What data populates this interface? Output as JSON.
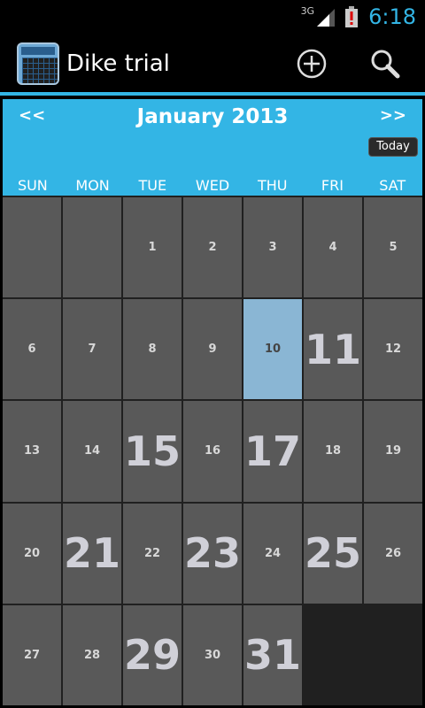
{
  "status_bar": {
    "network": "3G",
    "time": "6:18",
    "accent": "#33b5e5"
  },
  "action_bar": {
    "title": "Dike trial",
    "icons": [
      "calendar-app-icon",
      "add-icon",
      "search-icon"
    ]
  },
  "calendar": {
    "nav_prev": "<<",
    "nav_next": ">>",
    "month": "January 2013",
    "today_label": "Today",
    "weekdays": [
      "SUN",
      "MON",
      "TUE",
      "WED",
      "THU",
      "FRI",
      "SAT"
    ],
    "days": [
      {
        "label": "",
        "size": "blank"
      },
      {
        "label": "",
        "size": "blank"
      },
      {
        "label": "1",
        "size": "small"
      },
      {
        "label": "2",
        "size": "small"
      },
      {
        "label": "3",
        "size": "small"
      },
      {
        "label": "4",
        "size": "small"
      },
      {
        "label": "5",
        "size": "small"
      },
      {
        "label": "6",
        "size": "small"
      },
      {
        "label": "7",
        "size": "small"
      },
      {
        "label": "8",
        "size": "small"
      },
      {
        "label": "9",
        "size": "small"
      },
      {
        "label": "10",
        "size": "small",
        "selected": true
      },
      {
        "label": "11",
        "size": "big"
      },
      {
        "label": "12",
        "size": "small"
      },
      {
        "label": "13",
        "size": "small"
      },
      {
        "label": "14",
        "size": "small"
      },
      {
        "label": "15",
        "size": "big"
      },
      {
        "label": "16",
        "size": "small"
      },
      {
        "label": "17",
        "size": "big"
      },
      {
        "label": "18",
        "size": "small"
      },
      {
        "label": "19",
        "size": "small"
      },
      {
        "label": "20",
        "size": "small"
      },
      {
        "label": "21",
        "size": "big"
      },
      {
        "label": "22",
        "size": "small"
      },
      {
        "label": "23",
        "size": "big"
      },
      {
        "label": "24",
        "size": "small"
      },
      {
        "label": "25",
        "size": "big"
      },
      {
        "label": "26",
        "size": "small"
      },
      {
        "label": "27",
        "size": "small"
      },
      {
        "label": "28",
        "size": "small"
      },
      {
        "label": "29",
        "size": "big"
      },
      {
        "label": "30",
        "size": "small"
      },
      {
        "label": "31",
        "size": "big"
      }
    ],
    "selected_color": "#8ab6d4",
    "cell_color": "#595959"
  }
}
